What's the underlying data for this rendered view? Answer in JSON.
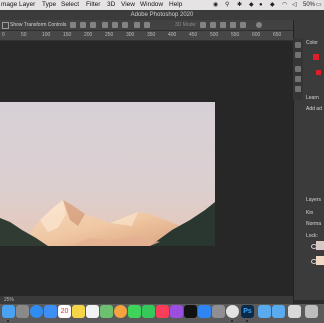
{
  "menubar": {
    "items": [
      "mage",
      "Layer",
      "Type",
      "Select",
      "Filter",
      "3D",
      "View",
      "Window",
      "Help"
    ],
    "battery_percent": "50%"
  },
  "window": {
    "title": "Adobe Photoshop 2020"
  },
  "options_bar": {
    "show_transform_controls_label": "Show Transform Controls",
    "mode_text": "3D Mode:"
  },
  "ruler": {
    "labels": [
      "0",
      "50",
      "100",
      "150",
      "200",
      "250",
      "300",
      "350",
      "400",
      "450",
      "500",
      "550",
      "600",
      "650"
    ]
  },
  "right_panel": {
    "color_label": "Color",
    "learn_label": "Learn",
    "add_label": "Add ad",
    "layers_label": "Layers",
    "kind_label": "Kin",
    "normal_label": "Norma",
    "lock_label": "Lock:"
  },
  "status": {
    "zoom": "25%"
  },
  "dock": {
    "icons": [
      "finder-icon",
      "launchpad-icon",
      "safari-icon",
      "mail-icon",
      "calendar-icon",
      "notes-icon",
      "reminders-icon",
      "maps-icon",
      "photos-icon",
      "messages-icon",
      "facetime-icon",
      "music-icon",
      "podcasts-icon",
      "tv-icon",
      "app-store-icon",
      "system-preferences-icon",
      "preview-icon",
      "chrome-icon",
      "photoshop-icon",
      "folder-icon",
      "downloads-icon",
      "trash-icon"
    ],
    "calendar_day": "20",
    "photoshop_label": "Ps",
    "colors": {
      "finder": "#4aa3f0",
      "launchpad": "#8a8a8a",
      "safari": "#2f8cf0",
      "mail": "#3e8ff5",
      "calendar": "#ffffff",
      "notes": "#f5d547",
      "reminders": "#f2f2f2",
      "maps": "#6cc070",
      "photos": "#f4a340",
      "messages": "#3ed45a",
      "facetime": "#35c85a",
      "music": "#fa3e5a",
      "podcasts": "#9a4fe0",
      "tv": "#111111",
      "appstore": "#2f86f2",
      "sysprefs": "#8e8e93",
      "preview": "#6aa0d8",
      "chrome": "#e3e3e3",
      "photoshop": "#0b2a4a",
      "folder": "#5aaaf0",
      "downloads": "#5aaaf0",
      "trash": "#bdbdbd"
    }
  }
}
